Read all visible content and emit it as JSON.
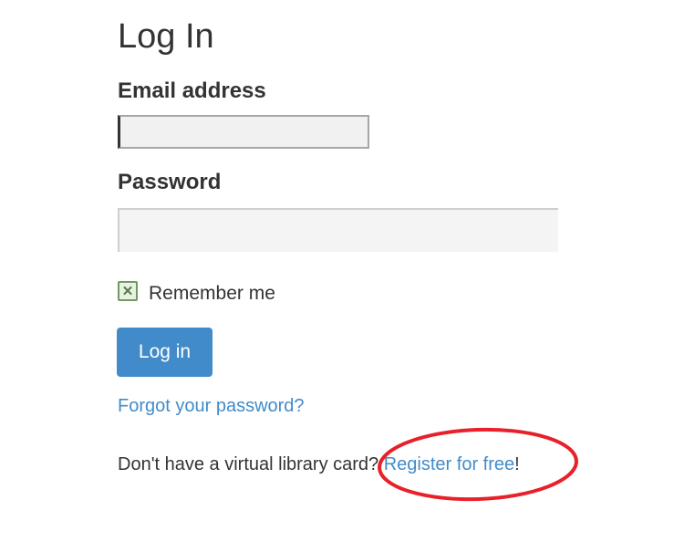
{
  "login": {
    "title": "Log In",
    "email_label": "Email address",
    "email_value": "",
    "email_placeholder": "",
    "password_label": "Password",
    "password_value": "",
    "password_placeholder": "",
    "remember_label": "Remember me",
    "remember_checked": true,
    "login_button": "Log in",
    "forgot_link": "Forgot your password?",
    "register_prompt": "Don't have a virtual library card? ",
    "register_link": "Register for free",
    "register_suffix": "!"
  },
  "colors": {
    "accent": "#428bca",
    "annotation": "#e8202a"
  }
}
